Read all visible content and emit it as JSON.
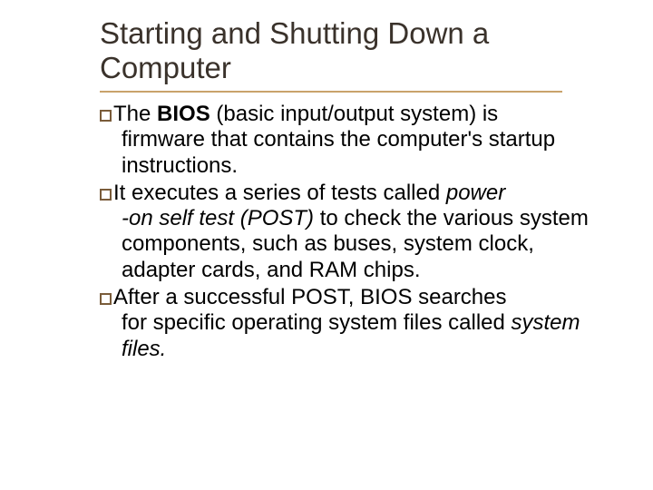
{
  "title": "Starting and Shutting Down a Computer",
  "bullets": [
    {
      "pre": "The ",
      "bold": "BIOS",
      "mid": " (basic input/output system) is",
      "cont": "firmware that contains the computer's startup instructions."
    },
    {
      "pre": "It executes a series of tests called ",
      "italic1": "power",
      "cont_pre_italic": "",
      "italic2": "-on self test (POST) ",
      "cont": "to check the various system components, such as buses, system clock, adapter cards, and RAM chips."
    },
    {
      "pre": "After a successful POST, BIOS searches",
      "cont_pre": "for specific operating system files called ",
      "italic": "system files."
    }
  ]
}
